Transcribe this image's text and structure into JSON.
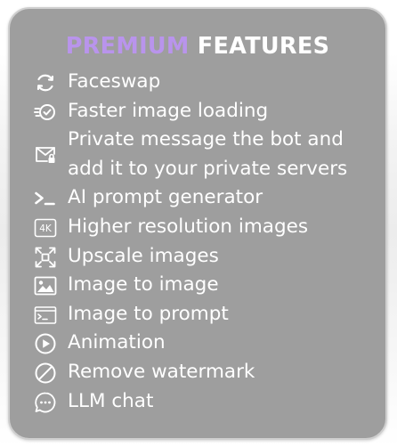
{
  "title": {
    "premium": "PREMIUM",
    "features": "FEATURES"
  },
  "features": [
    {
      "label": "Faceswap",
      "icon": "refresh-icon"
    },
    {
      "label": "Faster image loading",
      "icon": "fast-check-icon"
    },
    {
      "label_line1": "Private message the bot and",
      "label_line2": "add it to your private servers",
      "icon": "mail-lock-icon"
    },
    {
      "label": "AI prompt generator",
      "icon": "terminal-prompt-icon"
    },
    {
      "label": "Higher resolution images",
      "icon": "4k-icon"
    },
    {
      "label": "Upscale images",
      "icon": "upscale-icon"
    },
    {
      "label": "Image to image",
      "icon": "image-icon"
    },
    {
      "label": "Image to prompt",
      "icon": "terminal-window-icon"
    },
    {
      "label": "Animation",
      "icon": "play-circle-icon"
    },
    {
      "label": "Remove watermark",
      "icon": "prohibited-icon"
    },
    {
      "label": "LLM chat",
      "icon": "chat-bubble-icon"
    }
  ],
  "colors": {
    "card_bg": "#9e9e9e",
    "premium_accent": "#b994ec",
    "text": "#ffffff"
  }
}
